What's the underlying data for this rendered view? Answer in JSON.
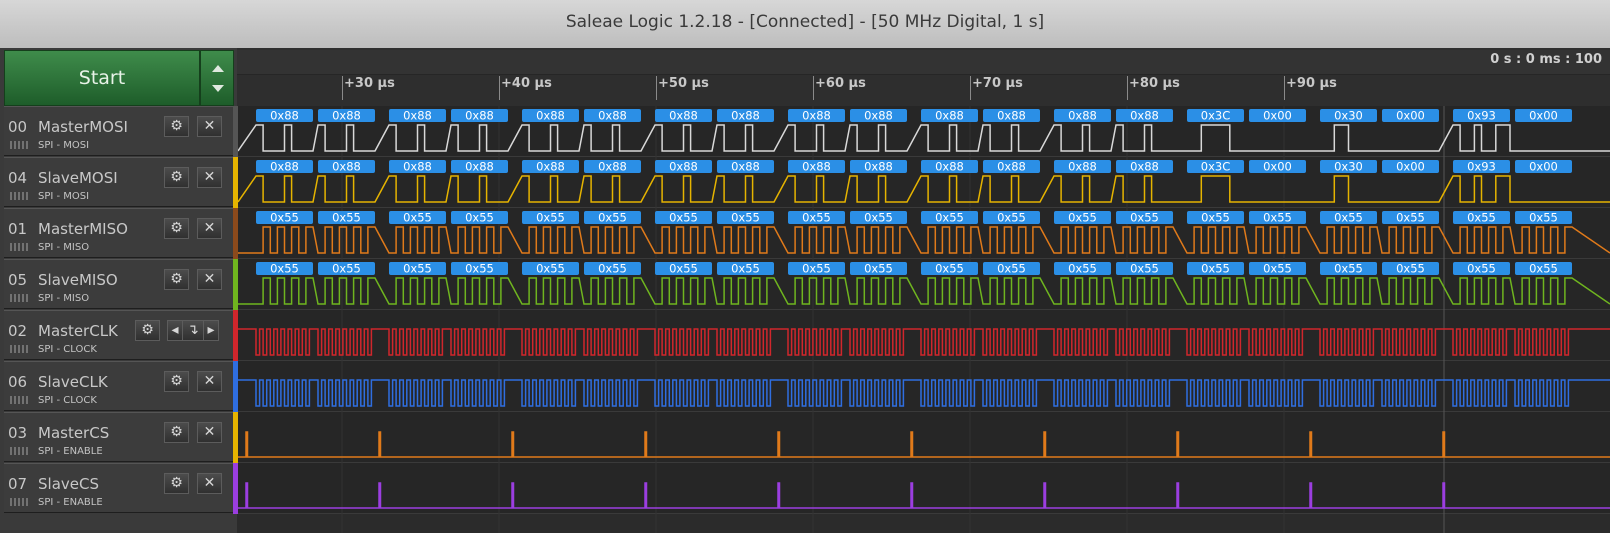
{
  "window": {
    "title": "Saleae Logic 1.2.18 - [Connected] - [50 MHz Digital, 1 s]"
  },
  "controls": {
    "start_label": "Start"
  },
  "timeline": {
    "cursor_time": "0 s : 0 ms : 100",
    "ticks": [
      "+30 µs",
      "+40 µs",
      "+50 µs",
      "+60 µs",
      "+70 µs",
      "+80 µs",
      "+90 µs"
    ]
  },
  "icons": {
    "settings": "gear-icon",
    "remove": "close-icon",
    "edge_prev": "chevron-left-icon",
    "edge_trigger": "falling-edge-trigger-icon",
    "edge_next": "chevron-right-icon",
    "scroll": "up-down-arrows-icon"
  },
  "channels": [
    {
      "num": "00",
      "name": "MasterMOSI",
      "analyzer": "SPI - MOSI",
      "color": "#d9d9d9",
      "bar": "#555555",
      "kind": "data",
      "bytes": [
        "0x88",
        "0x88",
        "0x88",
        "0x88",
        "0x88",
        "0x88",
        "0x88",
        "0x88",
        "0x88",
        "0x88",
        "0x88",
        "0x88",
        "0x88",
        "0x88",
        "0x3C",
        "0x00",
        "0x30",
        "0x00",
        "0x93",
        "0x00"
      ]
    },
    {
      "num": "04",
      "name": "SlaveMOSI",
      "analyzer": "SPI - MOSI",
      "color": "#e6b400",
      "bar": "#e6b400",
      "kind": "data",
      "bytes": [
        "0x88",
        "0x88",
        "0x88",
        "0x88",
        "0x88",
        "0x88",
        "0x88",
        "0x88",
        "0x88",
        "0x88",
        "0x88",
        "0x88",
        "0x88",
        "0x88",
        "0x3C",
        "0x00",
        "0x30",
        "0x00",
        "0x93",
        "0x00"
      ]
    },
    {
      "num": "01",
      "name": "MasterMISO",
      "analyzer": "SPI - MISO",
      "color": "#e07a1a",
      "bar": "#8b4a1c",
      "kind": "miso",
      "bytes": [
        "0x55",
        "0x55",
        "0x55",
        "0x55",
        "0x55",
        "0x55",
        "0x55",
        "0x55",
        "0x55",
        "0x55",
        "0x55",
        "0x55",
        "0x55",
        "0x55",
        "0x55",
        "0x55",
        "0x55",
        "0x55",
        "0x55",
        "0x55"
      ]
    },
    {
      "num": "05",
      "name": "SlaveMISO",
      "analyzer": "SPI - MISO",
      "color": "#6fb51f",
      "bar": "#6fb51f",
      "kind": "miso",
      "bytes": [
        "0x55",
        "0x55",
        "0x55",
        "0x55",
        "0x55",
        "0x55",
        "0x55",
        "0x55",
        "0x55",
        "0x55",
        "0x55",
        "0x55",
        "0x55",
        "0x55",
        "0x55",
        "0x55",
        "0x55",
        "0x55",
        "0x55",
        "0x55"
      ]
    },
    {
      "num": "02",
      "name": "MasterCLK",
      "analyzer": "SPI - CLOCK",
      "color": "#d0262c",
      "bar": "#d0262c",
      "kind": "clk",
      "bytes": []
    },
    {
      "num": "06",
      "name": "SlaveCLK",
      "analyzer": "SPI - CLOCK",
      "color": "#2f6ee0",
      "bar": "#2f6ee0",
      "kind": "clk",
      "bytes": []
    },
    {
      "num": "03",
      "name": "MasterCS",
      "analyzer": "SPI - ENABLE",
      "color": "#e07a1a",
      "bar": "#e6b400",
      "kind": "cs",
      "bytes": []
    },
    {
      "num": "07",
      "name": "SlaveCS",
      "analyzer": "SPI - ENABLE",
      "color": "#9b3ee0",
      "bar": "#9b3ee0",
      "kind": "cs",
      "bytes": []
    }
  ],
  "colors": {
    "byte_bubble": "#2b8fe6",
    "byte_text": "#ffffff",
    "start_green": "#2f7a3c"
  }
}
